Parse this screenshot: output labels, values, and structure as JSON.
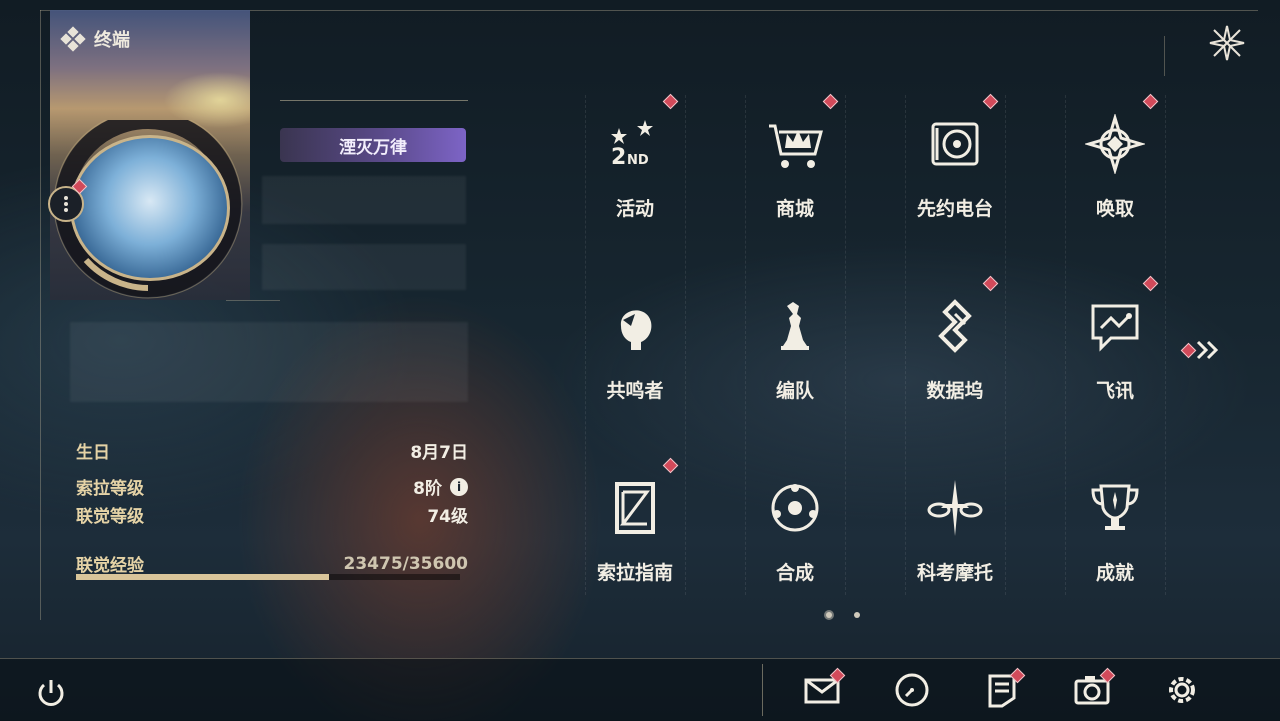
{
  "header": {
    "title": "终端",
    "title_icon": "diamond-cluster-icon",
    "close_icon": "close-star-icon"
  },
  "profile": {
    "title_plate": "湮灭万律",
    "stats": [
      {
        "label": "生日",
        "value": "8月7日"
      },
      {
        "label": "索拉等级",
        "value": "8阶",
        "has_info": true
      },
      {
        "label": "联觉等级",
        "value": "74级"
      }
    ],
    "exp": {
      "label": "联觉经验",
      "value": "23475/35600",
      "current": 23475,
      "max": 35600
    }
  },
  "menu": {
    "items": [
      {
        "label": "活动",
        "icon": "event-2nd-anniversary-icon",
        "badge": true
      },
      {
        "label": "商城",
        "icon": "shop-cart-crown-icon",
        "badge": true
      },
      {
        "label": "先约电台",
        "icon": "radio-record-icon",
        "badge": true
      },
      {
        "label": "唤取",
        "icon": "summon-compass-icon",
        "badge": true
      },
      {
        "label": "共鸣者",
        "icon": "resonator-head-icon",
        "badge": false
      },
      {
        "label": "编队",
        "icon": "team-chess-icon",
        "badge": false
      },
      {
        "label": "数据坞",
        "icon": "data-bank-icon",
        "badge": true
      },
      {
        "label": "飞讯",
        "icon": "message-chat-icon",
        "badge": true
      },
      {
        "label": "索拉指南",
        "icon": "guidebook-icon",
        "badge": true
      },
      {
        "label": "合成",
        "icon": "synthesis-orbit-icon",
        "badge": false
      },
      {
        "label": "科考摩托",
        "icon": "motorcycle-icon",
        "badge": false
      },
      {
        "label": "成就",
        "icon": "trophy-icon",
        "badge": false
      }
    ],
    "page_indicator": {
      "current": 1,
      "total": 2
    }
  },
  "bottom_bar": {
    "icons": [
      {
        "name": "mail-icon",
        "badge": true
      },
      {
        "name": "clock-icon",
        "badge": false
      },
      {
        "name": "notice-icon",
        "badge": true
      },
      {
        "name": "camera-icon",
        "badge": true
      },
      {
        "name": "settings-gear-icon",
        "badge": false
      }
    ]
  },
  "colors": {
    "accent_gold": "#d9c59a",
    "badge_red": "#d24a5a",
    "text": "#f2eee4"
  }
}
